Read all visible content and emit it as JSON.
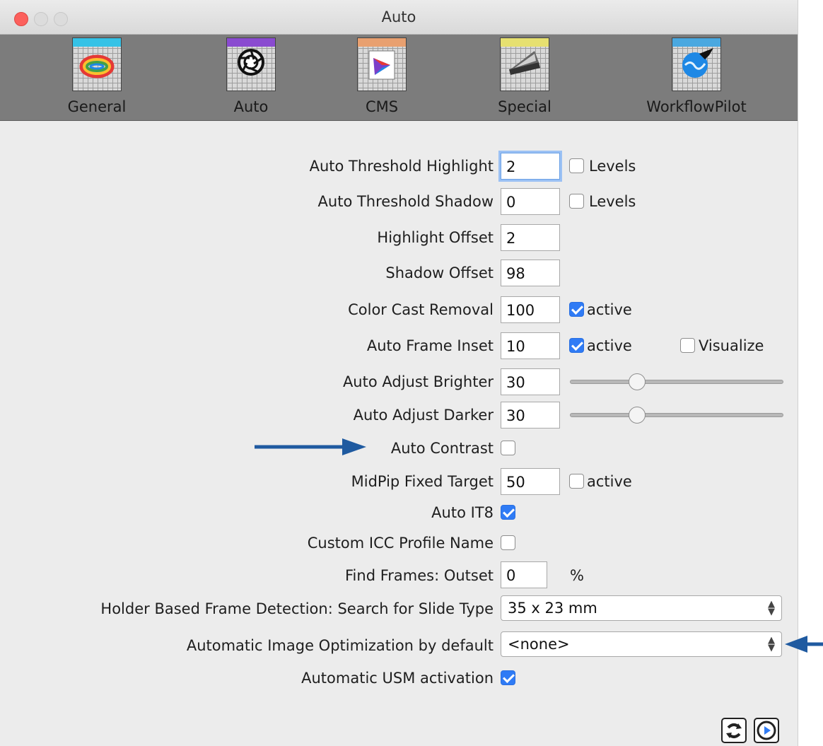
{
  "window": {
    "title": "Auto"
  },
  "toolbar": {
    "items": [
      {
        "label": "General",
        "icon": "color-ring-icon",
        "strip": "#35c2e6"
      },
      {
        "label": "Auto",
        "icon": "aperture-icon",
        "strip": "#8a4bd0"
      },
      {
        "label": "CMS",
        "icon": "color-gamut-icon",
        "strip": "#e8a070"
      },
      {
        "label": "Special",
        "icon": "scanner-icon",
        "strip": "#e6e070"
      },
      {
        "label": "WorkflowPilot",
        "icon": "globe-plane-icon",
        "strip": "#4aa8e0"
      }
    ]
  },
  "form": {
    "auto_threshold_highlight": {
      "label": "Auto Threshold Highlight",
      "value": "2",
      "levels_label": "Levels",
      "levels": false
    },
    "auto_threshold_shadow": {
      "label": "Auto Threshold Shadow",
      "value": "0",
      "levels_label": "Levels",
      "levels": false
    },
    "highlight_offset": {
      "label": "Highlight Offset",
      "value": "2"
    },
    "shadow_offset": {
      "label": "Shadow Offset",
      "value": "98"
    },
    "color_cast_removal": {
      "label": "Color Cast Removal",
      "value": "100",
      "active_label": "active",
      "active": true
    },
    "auto_frame_inset": {
      "label": "Auto Frame Inset",
      "value": "10",
      "active_label": "active",
      "active": true,
      "visualize_label": "Visualize",
      "visualize": false
    },
    "auto_adjust_brighter": {
      "label": "Auto Adjust Brighter",
      "value": "30",
      "slider_level": 0.3
    },
    "auto_adjust_darker": {
      "label": "Auto Adjust Darker",
      "value": "30",
      "slider_level": 0.3
    },
    "auto_contrast": {
      "label": "Auto Contrast",
      "checked": false
    },
    "midpip_fixed_target": {
      "label": "MidPip Fixed Target",
      "value": "50",
      "active_label": "active",
      "active": false
    },
    "auto_it8": {
      "label": "Auto IT8",
      "checked": true
    },
    "custom_icc_profile_name": {
      "label": "Custom ICC Profile Name",
      "checked": false
    },
    "find_frames_outset": {
      "label": "Find Frames: Outset",
      "value": "0",
      "unit": "%"
    },
    "holder_based_frame_detection": {
      "label": "Holder Based Frame Detection: Search for Slide Type",
      "selected": "35 x 23 mm"
    },
    "automatic_image_optimization": {
      "label": "Automatic Image Optimization by default",
      "selected": "<none>"
    },
    "automatic_usm_activation": {
      "label": "Automatic USM activation",
      "checked": true
    }
  },
  "colors": {
    "accent": "#2f7bf5",
    "annotation_arrow": "#1f5aa0",
    "toolbar_bg": "#7c7c7c"
  }
}
